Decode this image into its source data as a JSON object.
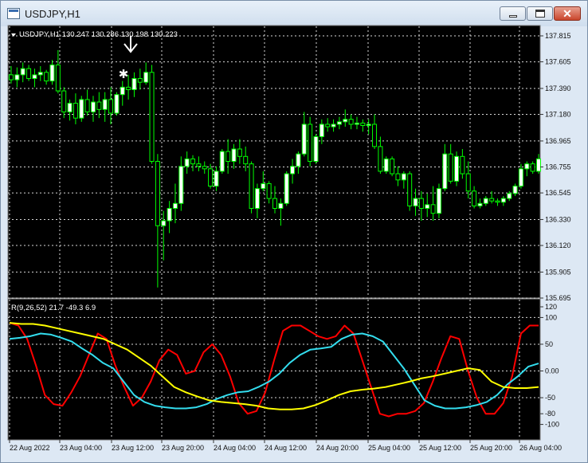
{
  "window": {
    "title": "USDJPY,H1",
    "close_glyph": "✕"
  },
  "colors": {
    "bull": "#00ff00",
    "up_body": "#ffffff",
    "dn_body": "#000000",
    "line_red": "#ff0000",
    "line_cyan": "#33ddee",
    "line_yellow": "#ffff00",
    "grid": "#d8d8d8"
  },
  "icons": {
    "app": "chart-window-icon",
    "minimize": "minimize-icon",
    "maximize": "maximize-icon",
    "close": "close-icon",
    "arrow": "down-arrow-icon",
    "star": "star-marker-icon",
    "menu": "triangle-down-icon"
  },
  "price_chart": {
    "header": "USDJPY,H1  130.247 130.286 130.198 130.223",
    "axis_labels": [
      "137.815",
      "137.605",
      "137.390",
      "137.180",
      "136.965",
      "136.755",
      "136.545",
      "136.330",
      "136.120",
      "135.905",
      "135.695"
    ]
  },
  "indicator": {
    "header": "R(9,26,52) 21.7 -49.3 6.9",
    "axis_labels": [
      "120",
      "100",
      "50",
      "0.00",
      "-50",
      "-80",
      "-100"
    ]
  },
  "time_labels": [
    "22 Aug 2022",
    "23 Aug 04:00",
    "23 Aug 12:00",
    "23 Aug 20:00",
    "24 Aug 04:00",
    "24 Aug 12:00",
    "24 Aug 20:00",
    "25 Aug 04:00",
    "25 Aug 12:00",
    "25 Aug 20:00",
    "26 Aug 04:00"
  ],
  "chart_data": {
    "type": "line",
    "x": [
      "22 Aug 2022",
      "23 Aug 04:00",
      "23 Aug 12:00",
      "23 Aug 20:00",
      "24 Aug 04:00",
      "24 Aug 12:00",
      "24 Aug 20:00",
      "25 Aug 04:00",
      "25 Aug 12:00",
      "25 Aug 20:00",
      "26 Aug 04:00"
    ],
    "ylim": [
      135.695,
      137.815
    ],
    "candles": [
      [
        137.5,
        137.57,
        137.43,
        137.46
      ],
      [
        137.46,
        137.56,
        137.4,
        137.5
      ],
      [
        137.5,
        137.6,
        137.44,
        137.55
      ],
      [
        137.55,
        137.58,
        137.45,
        137.47
      ],
      [
        137.47,
        137.55,
        137.4,
        137.5
      ],
      [
        137.5,
        137.57,
        137.45,
        137.52
      ],
      [
        137.52,
        137.54,
        137.42,
        137.45
      ],
      [
        137.45,
        137.62,
        137.42,
        137.58
      ],
      [
        137.58,
        137.7,
        137.35,
        137.37
      ],
      [
        137.37,
        137.4,
        137.15,
        137.2
      ],
      [
        137.2,
        137.3,
        137.13,
        137.27
      ],
      [
        137.27,
        137.35,
        137.1,
        137.15
      ],
      [
        137.15,
        137.33,
        137.12,
        137.3
      ],
      [
        137.3,
        137.38,
        137.17,
        137.2
      ],
      [
        137.2,
        137.33,
        137.12,
        137.28
      ],
      [
        137.28,
        137.36,
        137.15,
        137.22
      ],
      [
        137.22,
        137.36,
        137.12,
        137.3
      ],
      [
        137.3,
        137.4,
        137.1,
        137.19
      ],
      [
        137.19,
        137.36,
        137.17,
        137.34
      ],
      [
        137.34,
        137.45,
        137.25,
        137.4
      ],
      [
        137.4,
        137.5,
        137.3,
        137.38
      ],
      [
        137.38,
        137.52,
        137.32,
        137.47
      ],
      [
        137.47,
        137.55,
        137.38,
        137.44
      ],
      [
        137.44,
        137.6,
        137.42,
        137.52
      ],
      [
        137.52,
        137.58,
        136.78,
        136.8
      ],
      [
        136.8,
        136.86,
        135.78,
        136.28
      ],
      [
        136.28,
        136.4,
        136.0,
        136.32
      ],
      [
        136.32,
        136.48,
        136.22,
        136.42
      ],
      [
        136.42,
        136.62,
        136.3,
        136.46
      ],
      [
        136.46,
        136.84,
        136.4,
        136.76
      ],
      [
        136.76,
        136.88,
        136.7,
        136.82
      ],
      [
        136.82,
        136.85,
        136.72,
        136.78
      ],
      [
        136.78,
        136.84,
        136.72,
        136.76
      ],
      [
        136.76,
        136.8,
        136.7,
        136.74
      ],
      [
        136.74,
        136.78,
        136.58,
        136.6
      ],
      [
        136.6,
        136.76,
        136.56,
        136.72
      ],
      [
        136.72,
        136.9,
        136.7,
        136.88
      ],
      [
        136.88,
        136.98,
        136.7,
        136.8
      ],
      [
        136.8,
        136.94,
        136.74,
        136.9
      ],
      [
        136.9,
        136.98,
        136.78,
        136.84
      ],
      [
        136.84,
        136.92,
        136.72,
        136.78
      ],
      [
        136.78,
        136.8,
        136.38,
        136.42
      ],
      [
        136.42,
        136.62,
        136.34,
        136.58
      ],
      [
        136.58,
        136.72,
        136.56,
        136.62
      ],
      [
        136.62,
        136.64,
        136.46,
        136.5
      ],
      [
        136.5,
        136.6,
        136.38,
        136.42
      ],
      [
        136.42,
        136.5,
        136.28,
        136.46
      ],
      [
        136.46,
        136.72,
        136.44,
        136.7
      ],
      [
        136.7,
        136.82,
        136.62,
        136.76
      ],
      [
        136.76,
        136.88,
        136.7,
        136.86
      ],
      [
        136.86,
        137.2,
        136.84,
        137.1
      ],
      [
        137.1,
        137.16,
        136.76,
        136.8
      ],
      [
        136.8,
        137.02,
        136.78,
        137.0
      ],
      [
        137.0,
        137.14,
        136.94,
        137.1
      ],
      [
        137.1,
        137.15,
        137.04,
        137.08
      ],
      [
        137.08,
        137.14,
        137.04,
        137.1
      ],
      [
        137.1,
        137.16,
        137.06,
        137.12
      ],
      [
        137.12,
        137.22,
        137.08,
        137.14
      ],
      [
        137.14,
        137.18,
        137.06,
        137.1
      ],
      [
        137.1,
        137.16,
        137.06,
        137.11
      ],
      [
        137.11,
        137.14,
        137.04,
        137.09
      ],
      [
        137.09,
        137.14,
        137.02,
        137.1
      ],
      [
        137.1,
        137.18,
        136.9,
        136.92
      ],
      [
        136.92,
        137.0,
        136.7,
        136.72
      ],
      [
        136.72,
        136.84,
        136.7,
        136.82
      ],
      [
        136.82,
        136.84,
        136.68,
        136.7
      ],
      [
        136.7,
        136.76,
        136.6,
        136.65
      ],
      [
        136.65,
        136.72,
        136.58,
        136.7
      ],
      [
        136.7,
        136.72,
        136.4,
        136.44
      ],
      [
        136.44,
        136.58,
        136.36,
        136.5
      ],
      [
        136.5,
        136.56,
        136.32,
        136.42
      ],
      [
        136.42,
        136.54,
        136.35,
        136.45
      ],
      [
        136.45,
        136.6,
        136.32,
        136.38
      ],
      [
        136.38,
        136.62,
        136.34,
        136.58
      ],
      [
        136.58,
        136.94,
        136.56,
        136.86
      ],
      [
        136.86,
        136.94,
        136.62,
        136.64
      ],
      [
        136.64,
        136.88,
        136.6,
        136.84
      ],
      [
        136.84,
        136.9,
        136.66,
        136.7
      ],
      [
        136.7,
        136.8,
        136.5,
        136.56
      ],
      [
        136.56,
        136.6,
        136.42,
        136.44
      ],
      [
        136.44,
        136.5,
        136.42,
        136.46
      ],
      [
        136.46,
        136.52,
        136.44,
        136.5
      ],
      [
        136.5,
        136.56,
        136.46,
        136.48
      ],
      [
        136.48,
        136.5,
        136.44,
        136.47
      ],
      [
        136.47,
        136.52,
        136.44,
        136.5
      ],
      [
        136.5,
        136.56,
        136.48,
        136.54
      ],
      [
        136.54,
        136.62,
        136.52,
        136.6
      ],
      [
        136.6,
        136.78,
        136.58,
        136.74
      ],
      [
        136.74,
        136.8,
        136.68,
        136.78
      ],
      [
        136.78,
        136.8,
        136.7,
        136.72
      ],
      [
        136.72,
        136.86,
        136.7,
        136.82
      ]
    ],
    "indicator_ylim": [
      -120,
      120
    ],
    "series": [
      {
        "values": [
          90,
          85,
          60,
          10,
          -45,
          -62,
          -65,
          -40,
          -10,
          30,
          70,
          60,
          10,
          -30,
          -65,
          -50,
          -20,
          20,
          40,
          30,
          -5,
          0,
          35,
          50,
          30,
          -10,
          -60,
          -80,
          -75,
          -40,
          20,
          75,
          85,
          85,
          75,
          65,
          60,
          65,
          85,
          70,
          20,
          -30,
          -80,
          -85,
          -80,
          -80,
          -75,
          -60,
          -20,
          25,
          65,
          60,
          0,
          -50,
          -80,
          -80,
          -60,
          -10,
          70,
          85,
          85
        ]
      },
      {
        "values": [
          60,
          62,
          65,
          70,
          68,
          62,
          55,
          42,
          30,
          15,
          5,
          -20,
          -45,
          -58,
          -65,
          -68,
          -70,
          -70,
          -68,
          -62,
          -52,
          -45,
          -40,
          -38,
          -30,
          -20,
          -5,
          15,
          30,
          40,
          42,
          45,
          60,
          68,
          70,
          65,
          55,
          30,
          5,
          -25,
          -55,
          -65,
          -70,
          -70,
          -68,
          -64,
          -58,
          -45,
          -25,
          -10,
          8,
          14
        ]
      },
      {
        "values": [
          90,
          88,
          88,
          85,
          80,
          75,
          70,
          65,
          60,
          50,
          40,
          25,
          10,
          -10,
          -30,
          -40,
          -48,
          -55,
          -58,
          -60,
          -62,
          -65,
          -70,
          -72,
          -72,
          -70,
          -64,
          -55,
          -45,
          -38,
          -35,
          -33,
          -30,
          -25,
          -20,
          -14,
          -10,
          -5,
          0,
          5,
          2,
          -20,
          -30,
          -32,
          -32,
          -30
        ]
      }
    ]
  }
}
